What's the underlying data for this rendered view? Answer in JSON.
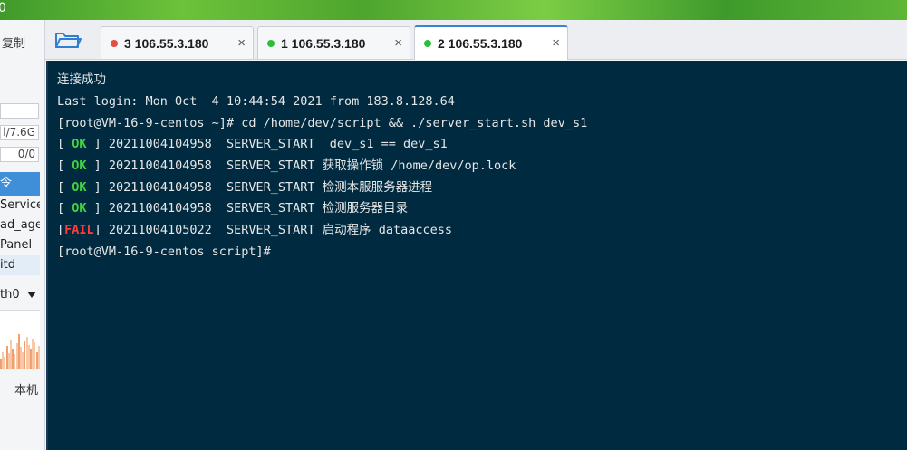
{
  "window": {
    "title_fragment": "0"
  },
  "sidebar": {
    "copy_label": "复制",
    "memory_value": "l/7.6G",
    "swap_value": "0/0",
    "selected_label": "令",
    "process_items": [
      "Service",
      "ad_age",
      "Panel",
      "itd"
    ],
    "network_interface": "th0",
    "local_label": "本机"
  },
  "tabs": [
    {
      "label": "3 106.55.3.180",
      "status_color": "#e74c3c",
      "close": "×",
      "active": false
    },
    {
      "label": "1 106.55.3.180",
      "status_color": "#2ebd3a",
      "close": "×",
      "active": false
    },
    {
      "label": "2 106.55.3.180",
      "status_color": "#2ebd3a",
      "close": "×",
      "active": true
    }
  ],
  "terminal": {
    "line1": "连接成功",
    "line2": "Last login: Mon Oct  4 10:44:54 2021 from 183.8.128.64",
    "line3": "[root@VM-16-9-centos ~]# cd /home/dev/script && ./server_start.sh dev_s1",
    "status_lines": [
      {
        "status": "OK",
        "text": "20211004104958  SERVER_START  dev_s1 == dev_s1"
      },
      {
        "status": "OK",
        "text": "20211004104958  SERVER_START 获取操作锁 /home/dev/op.lock"
      },
      {
        "status": "OK",
        "text": "20211004104958  SERVER_START 检测本服服务器进程"
      },
      {
        "status": "OK",
        "text": "20211004104958  SERVER_START 检测服务器目录"
      },
      {
        "status": "FAIL",
        "text": "20211004105022  SERVER_START 启动程序 dataaccess"
      }
    ],
    "prompt": "[root@VM-16-9-centos script]#"
  },
  "colors": {
    "terminal_bg": "#002a40",
    "ok": "#3fd43f",
    "fail": "#ff3b3b",
    "accent": "#3c82d0"
  },
  "icons": {
    "folder": "folder-open-icon",
    "close": "close-icon",
    "dropdown": "triangle-down-icon"
  }
}
